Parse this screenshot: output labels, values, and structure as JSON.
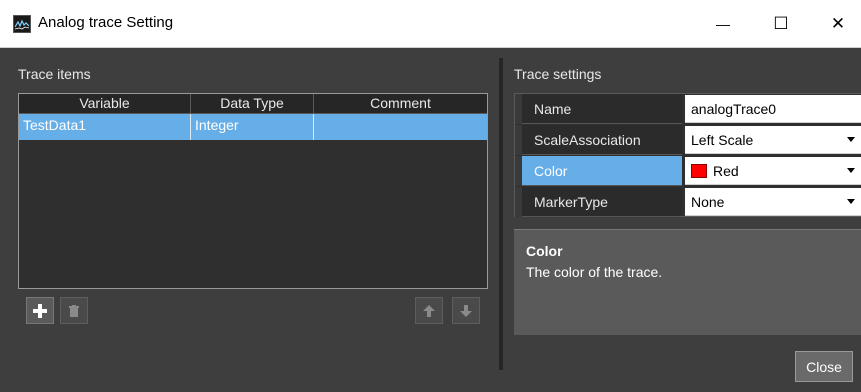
{
  "window": {
    "title": "Analog trace Setting",
    "minimize_glyph": "—",
    "maximize_glyph": "☐",
    "close_glyph": "✕"
  },
  "trace_items": {
    "title": "Trace items",
    "columns": [
      "Variable",
      "Data Type",
      "Comment"
    ],
    "rows": [
      {
        "variable": "TestData1",
        "data_type": "Integer",
        "comment": ""
      }
    ],
    "buttons": {
      "add_icon": "plus-icon",
      "delete_icon": "trash-icon",
      "up_icon": "arrow-up-icon",
      "down_icon": "arrow-down-icon"
    }
  },
  "trace_settings": {
    "title": "Trace settings",
    "properties": [
      {
        "name": "Name",
        "value": "analogTrace0",
        "dropdown": false
      },
      {
        "name": "ScaleAssociation",
        "value": "Left Scale",
        "dropdown": true
      },
      {
        "name": "Color",
        "value": "Red",
        "dropdown": true,
        "swatch": "#ff0000"
      },
      {
        "name": "MarkerType",
        "value": "None",
        "dropdown": true
      }
    ],
    "description": {
      "title": "Color",
      "text": "The color of the trace."
    }
  },
  "footer": {
    "close_label": "Close"
  },
  "colors": {
    "accent": "#66aee8",
    "background": "#3e3e3e",
    "panel": "#2f2f2f"
  }
}
